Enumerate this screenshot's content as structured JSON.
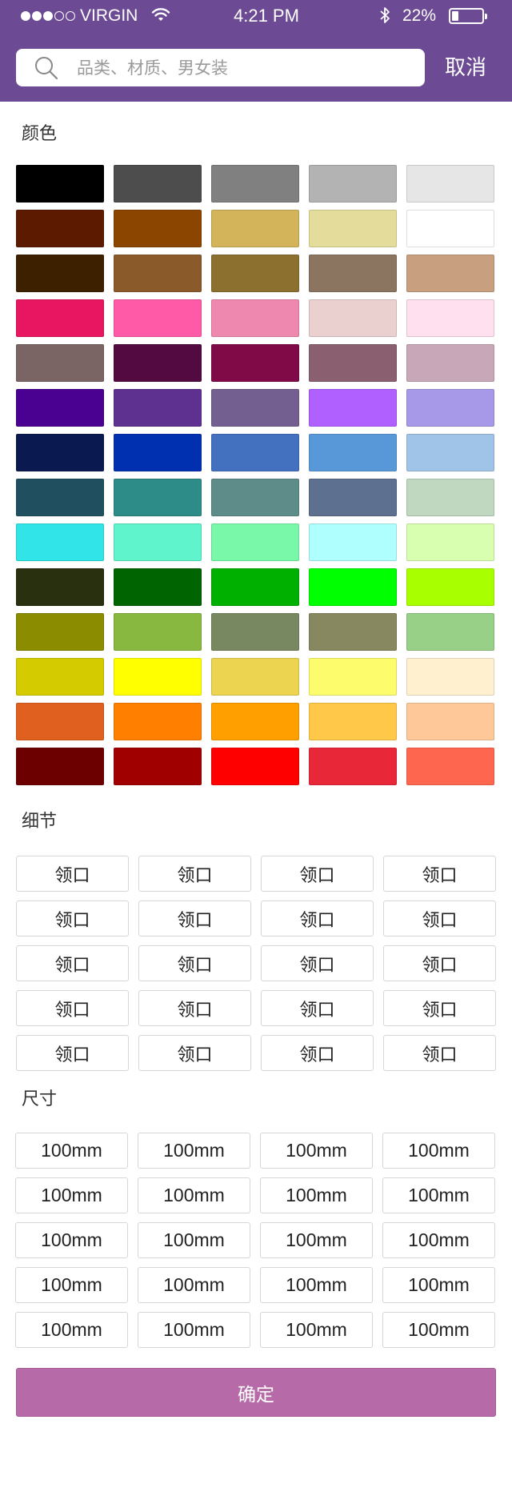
{
  "status_bar": {
    "signal": {
      "filled": 3,
      "total": 5
    },
    "carrier": "VIRGIN",
    "wifi_icon": "wifi-icon",
    "time": "4:21 PM",
    "bluetooth_icon": "bluetooth-icon",
    "battery": "22%",
    "battery_icon": "battery-icon"
  },
  "header": {
    "background": "#6c4a94",
    "search": {
      "icon": "search-icon",
      "placeholder": "品类、材质、男女装",
      "value": ""
    },
    "cancel_label": "取消"
  },
  "colors": {
    "title": "颜色",
    "rows": [
      [
        "#000000",
        "#4d4d4d",
        "#808080",
        "#b3b3b3",
        "#e6e6e6"
      ],
      [
        "#5c1a00",
        "#8b4500",
        "#d4b45a",
        "#e4dc9a",
        "#ffffff"
      ],
      [
        "#3d2000",
        "#8b5a2b",
        "#8b7030",
        "#8b7560",
        "#c8a080"
      ],
      [
        "#e81560",
        "#ff5aa8",
        "#ef88ae",
        "#ebd0d0",
        "#ffe0ee"
      ],
      [
        "#7a6464",
        "#520a40",
        "#800a48",
        "#8a6070",
        "#c8a8b8"
      ],
      [
        "#4a0090",
        "#5e3090",
        "#746090",
        "#b060ff",
        "#a898e8"
      ],
      [
        "#0a1a50",
        "#0030b0",
        "#4470c0",
        "#5898d8",
        "#a0c4e8"
      ],
      [
        "#205060",
        "#2e8c88",
        "#5e8c88",
        "#5e7090",
        "#c0d8c0"
      ],
      [
        "#30e4e8",
        "#60f4cc",
        "#78f8a8",
        "#b0ffff",
        "#d8ffb0"
      ],
      [
        "#283010",
        "#006400",
        "#00b000",
        "#00ff00",
        "#a8ff00"
      ],
      [
        "#8c8c00",
        "#88b840",
        "#788860",
        "#888860",
        "#98d088"
      ],
      [
        "#d4cc00",
        "#ffff00",
        "#ecd450",
        "#fcfc6c",
        "#fff0d0"
      ],
      [
        "#e06020",
        "#ff8000",
        "#ffa000",
        "#ffc848",
        "#ffc898"
      ],
      [
        "#6c0000",
        "#a00000",
        "#ff0000",
        "#e82838",
        "#ff6650"
      ]
    ]
  },
  "details": {
    "title": "细节",
    "rows": [
      [
        "领口",
        "领口",
        "领口",
        "领口"
      ],
      [
        "领口",
        "领口",
        "领口",
        "领口"
      ],
      [
        "领口",
        "领口",
        "领口",
        "领口"
      ],
      [
        "领口",
        "领口",
        "领口",
        "领口"
      ],
      [
        "领口",
        "领口",
        "领口",
        "领口"
      ]
    ]
  },
  "sizes": {
    "title": "尺寸",
    "rows": [
      [
        "100mm",
        "100mm",
        "100mm",
        "100mm"
      ],
      [
        "100mm",
        "100mm",
        "100mm",
        "100mm"
      ],
      [
        "100mm",
        "100mm",
        "100mm",
        "100mm"
      ],
      [
        "100mm",
        "100mm",
        "100mm",
        "100mm"
      ],
      [
        "100mm",
        "100mm",
        "100mm",
        "100mm"
      ]
    ]
  },
  "confirm": {
    "label": "确定",
    "color": "#b66aa7"
  }
}
